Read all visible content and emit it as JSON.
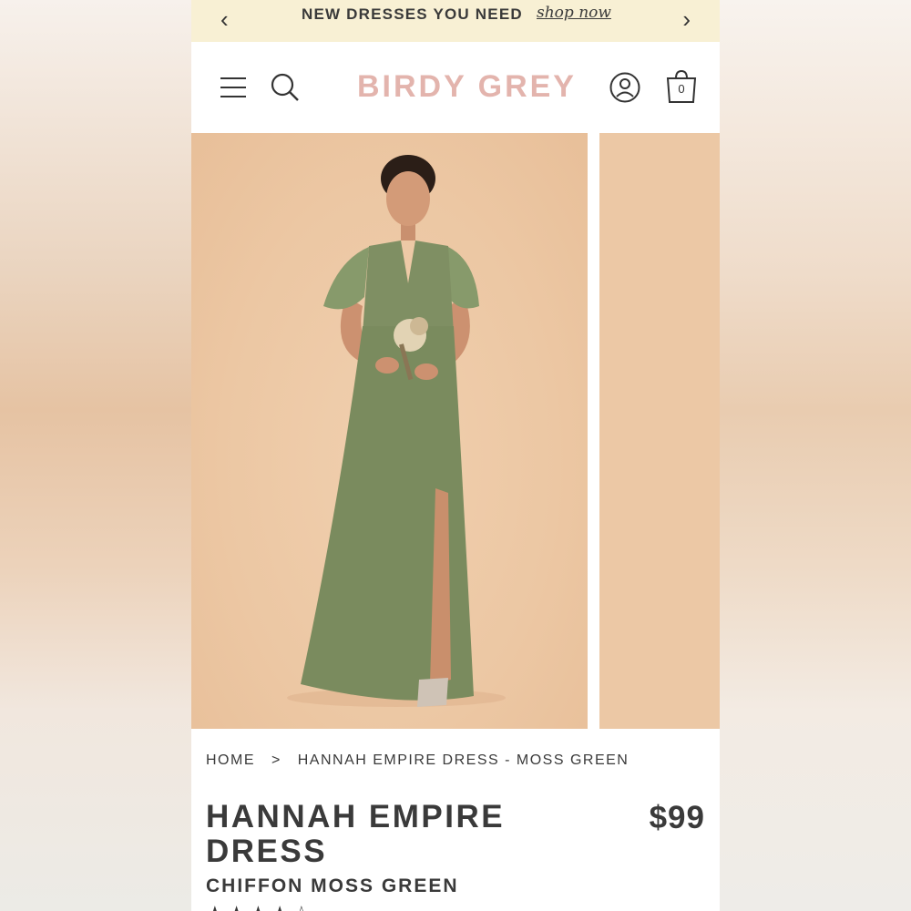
{
  "promo": {
    "message": "NEW DRESSES YOU NEED",
    "link": "shop now"
  },
  "header": {
    "logo": "BIRDY GREY",
    "cart_count": "0"
  },
  "breadcrumb": {
    "home": "HOME",
    "separator": ">",
    "current": "HANNAH EMPIRE DRESS - MOSS GREEN"
  },
  "product": {
    "title": "HANNAH EMPIRE DRESS",
    "price": "$99",
    "subtitle": "CHIFFON MOSS GREEN",
    "rating_stars": 4
  },
  "colors": {
    "promo_bg": "#f8f0d4",
    "logo": "#e3b4ad",
    "dress": "#7f8f63",
    "photo_bg": "#ecc8a5"
  }
}
